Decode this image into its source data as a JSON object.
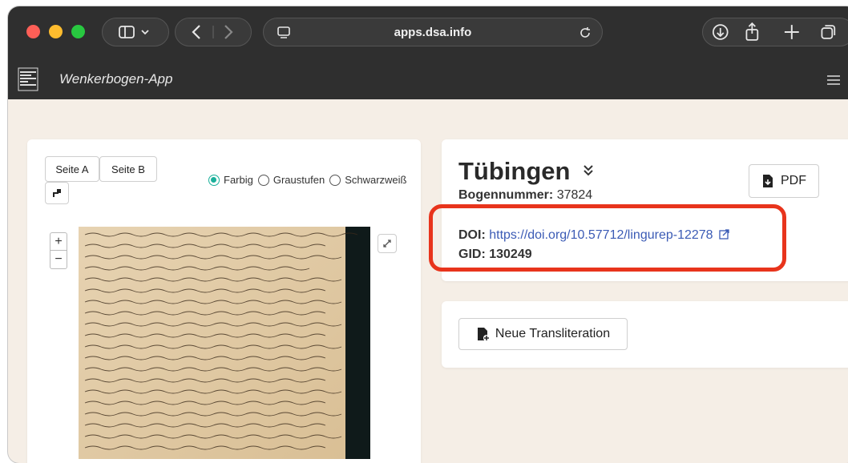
{
  "browser": {
    "url": "apps.dsa.info"
  },
  "app": {
    "title": "Wenkerbogen-App"
  },
  "viewer": {
    "tab_a": "Seite A",
    "tab_b": "Seite B",
    "color_modes": [
      "Farbig",
      "Graustufen",
      "Schwarzweiß"
    ],
    "selected_mode": "Farbig",
    "zoom_in": "+",
    "zoom_out": "−"
  },
  "details": {
    "place": "Tübingen",
    "bogennummer_label": "Bogennummer:",
    "bogennummer_value": "37824",
    "pdf_label": "PDF",
    "doi_label": "DOI:",
    "doi_link": "https://doi.org/10.57712/lingurep-12278",
    "gid_label": "GID:",
    "gid_value": "130249"
  },
  "actions": {
    "new_transliteration": "Neue Transliteration"
  },
  "colors": {
    "accent_teal": "#1ab09a",
    "highlight_red": "#e8341c",
    "link_blue": "#3b5bb5",
    "app_bar": "#2f2f2f",
    "background": "#f5eee6"
  }
}
